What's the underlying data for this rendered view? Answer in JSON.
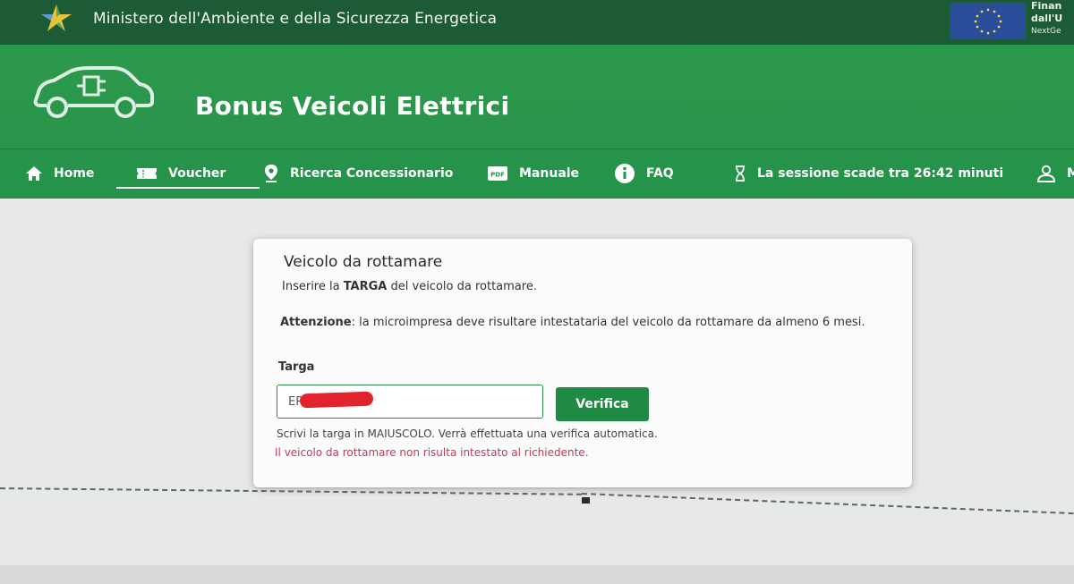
{
  "topbar": {
    "ministry": "Ministero dell'Ambiente e della Sicurezza Energetica",
    "eu_line1": "Finan",
    "eu_line2": "dall'U",
    "eu_line3": "NextGe"
  },
  "header": {
    "title": "Bonus Veicoli Elettrici"
  },
  "nav": {
    "home": "Home",
    "voucher": "Voucher",
    "ricerca": "Ricerca Concessionario",
    "manuale": "Manuale",
    "faq": "FAQ",
    "session": "La sessione scade tra 26:42 minuti",
    "user": "M"
  },
  "card": {
    "title": "Veicolo da rottamare",
    "instr_pre": "Inserire la ",
    "instr_bold": "TARGA",
    "instr_post": " del veicolo da rottamare.",
    "warn_bold": "Attenzione",
    "warn_text": ": la microimpresa deve risultare intestataria del veicolo da rottamare da almeno 6 mesi.",
    "label": "Targa",
    "input_value": "ER",
    "verify": "Verifica",
    "help": "Scrivi la targa in MAIUSCOLO. Verrà effettuata una verifica automatica.",
    "error": "Il veicolo da rottamare non risulta intestato al richiedente."
  },
  "colors": {
    "topbar": "#1d5a36",
    "header": "#2c9a4d",
    "nav": "#26934a",
    "button": "#1f8a43",
    "error": "#c23b55"
  }
}
